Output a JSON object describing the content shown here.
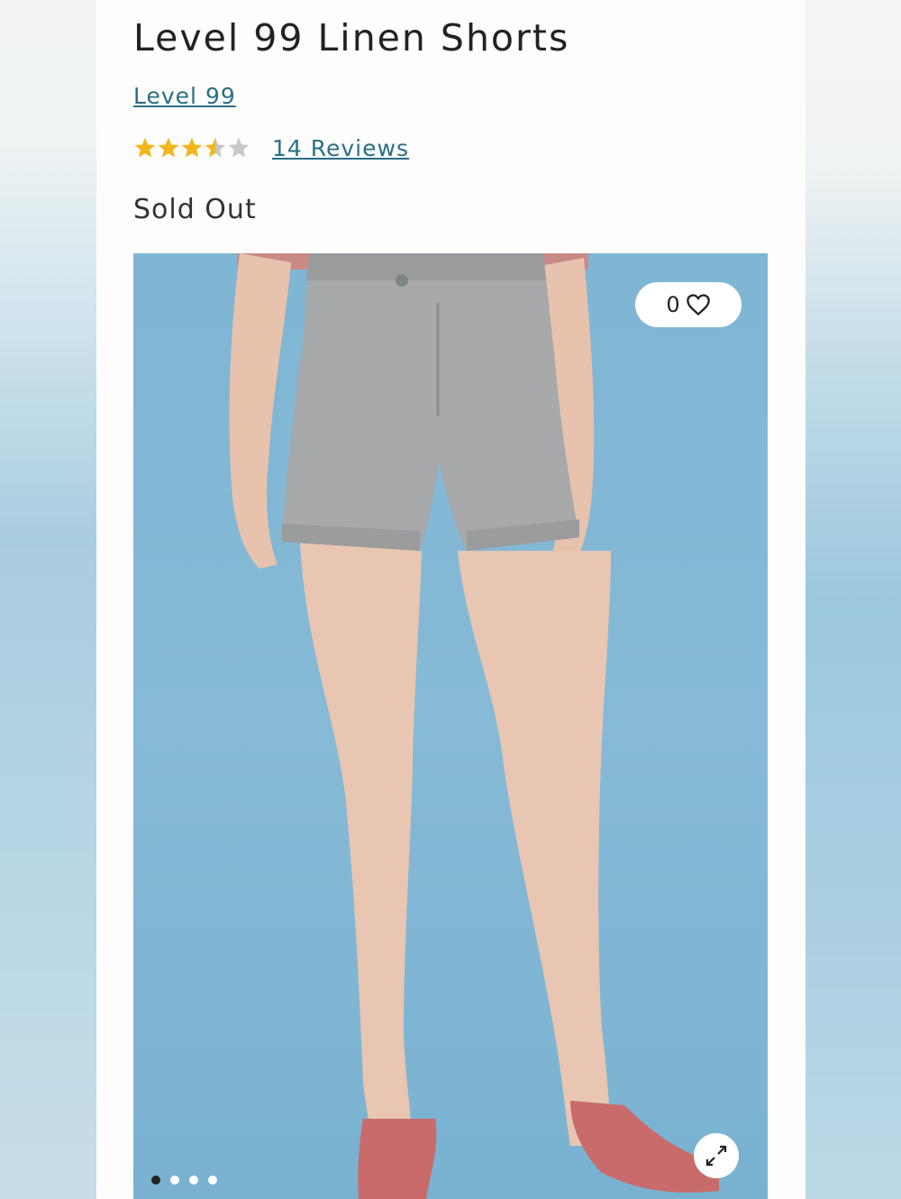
{
  "product": {
    "title": "Level 99 Linen Shorts",
    "brand": "Level 99",
    "rating": 3.5,
    "rating_max": 5,
    "reviews_label": "14 Reviews",
    "status": "Sold Out"
  },
  "gallery": {
    "favorite_count": "0",
    "image_count": 4,
    "active_index": 0
  },
  "colors": {
    "link": "#2a6f86",
    "star_filled": "#f2b51c",
    "star_empty": "#c8c8c8",
    "photo_background": "#86bad6"
  },
  "icons": {
    "favorite": "heart-icon",
    "expand": "expand-arrows-icon",
    "rating": "star-icon"
  }
}
